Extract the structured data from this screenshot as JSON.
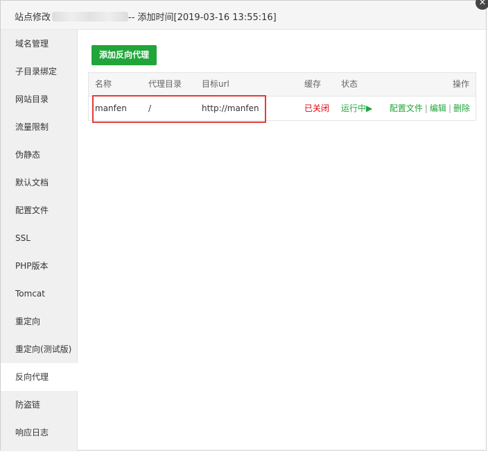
{
  "dialog": {
    "title_prefix": "站点修改",
    "title_suffix": "-- 添加时间[2019-03-16 13:55:16]",
    "close_label": "×"
  },
  "sidebar": {
    "items": [
      {
        "label": "域名管理"
      },
      {
        "label": "子目录绑定"
      },
      {
        "label": "网站目录"
      },
      {
        "label": "流量限制"
      },
      {
        "label": "伪静态"
      },
      {
        "label": "默认文档"
      },
      {
        "label": "配置文件"
      },
      {
        "label": "SSL"
      },
      {
        "label": "PHP版本"
      },
      {
        "label": "Tomcat"
      },
      {
        "label": "重定向"
      },
      {
        "label": "重定向(测试版)"
      },
      {
        "label": "反向代理"
      },
      {
        "label": "防盗链"
      },
      {
        "label": "响应日志"
      }
    ]
  },
  "main": {
    "add_button": "添加反向代理",
    "columns": {
      "name": "名称",
      "proxy_dir": "代理目录",
      "target_url": "目标url",
      "cache": "缓存",
      "status": "状态",
      "actions": "操作"
    },
    "rows": [
      {
        "name": "manfen",
        "proxy_dir": "/",
        "target_url": "http://manfen",
        "cache": "已关闭",
        "status": "运行中▶",
        "action_config": "配置文件",
        "action_sep1": "|",
        "action_edit": "编辑",
        "action_sep2": "|",
        "action_delete": "删除"
      }
    ]
  },
  "colors": {
    "accent_green": "#20a53a",
    "status_red": "#e3000b",
    "highlight_border": "#e53935"
  }
}
